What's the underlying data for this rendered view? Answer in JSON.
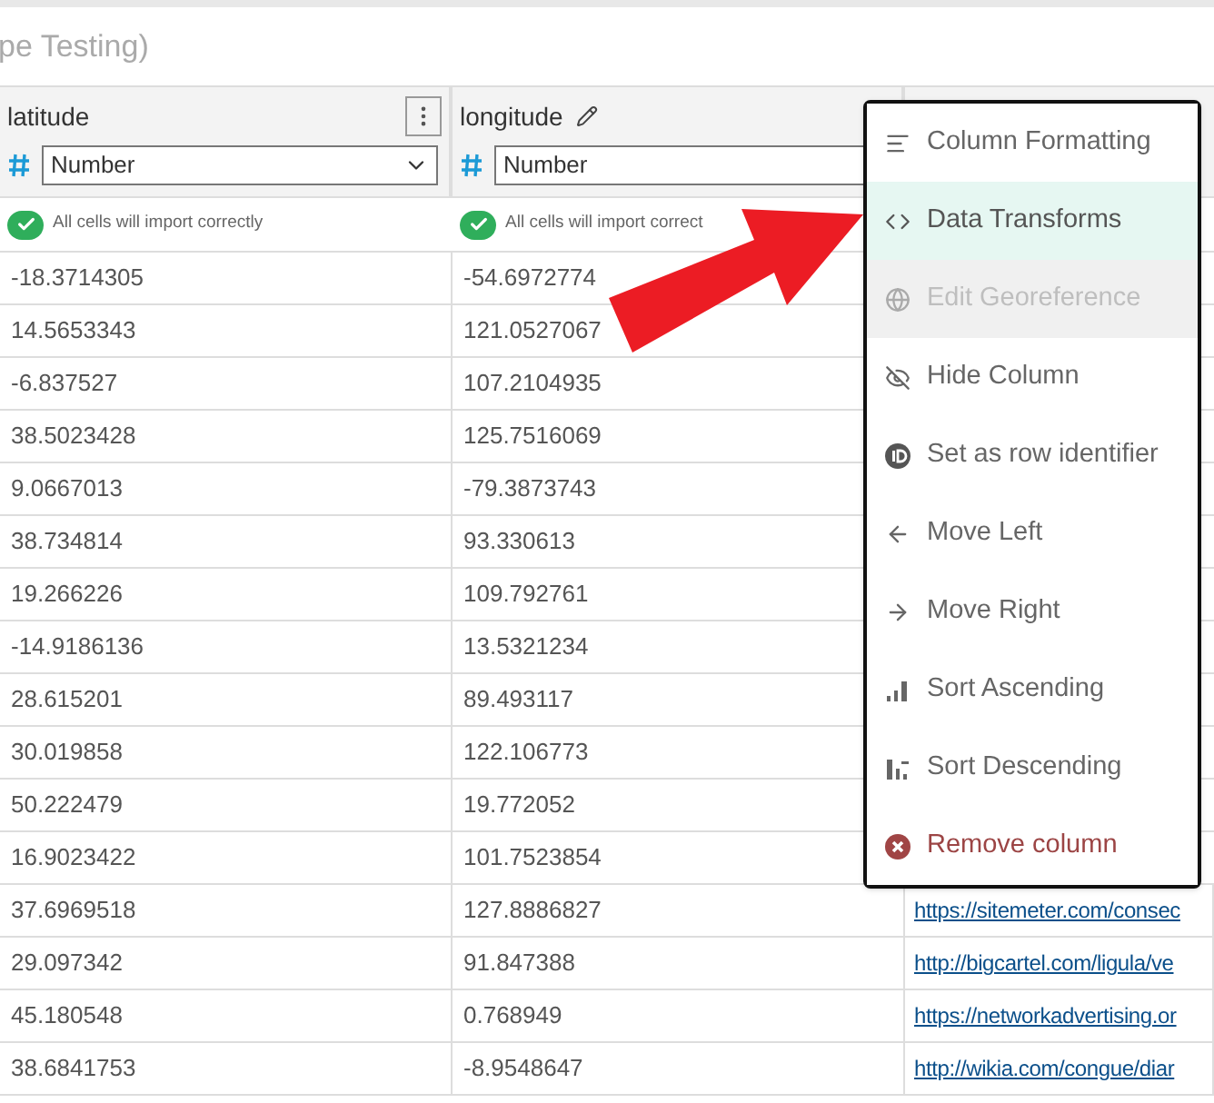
{
  "page_title": "pe Testing)",
  "columns": [
    {
      "name": "latitude",
      "kind": "menu",
      "type": "Number",
      "status": "All cells will import correctly"
    },
    {
      "name": "longitude",
      "kind": "edit",
      "type": "Number",
      "status": "All cells will import correct"
    }
  ],
  "rows": [
    {
      "cells": [
        "-18.3714305",
        "-54.6972774"
      ]
    },
    {
      "cells": [
        "14.5653343",
        "121.0527067"
      ]
    },
    {
      "cells": [
        "-6.837527",
        "107.2104935"
      ]
    },
    {
      "cells": [
        "38.5023428",
        "125.7516069"
      ]
    },
    {
      "cells": [
        "9.0667013",
        "-79.3873743"
      ]
    },
    {
      "cells": [
        "38.734814",
        "93.330613"
      ]
    },
    {
      "cells": [
        "19.266226",
        "109.792761"
      ]
    },
    {
      "cells": [
        "-14.9186136",
        "13.5321234"
      ]
    },
    {
      "cells": [
        "28.615201",
        "89.493117"
      ]
    },
    {
      "cells": [
        "30.019858",
        "122.106773"
      ]
    },
    {
      "cells": [
        "50.222479",
        "19.772052"
      ]
    },
    {
      "cells": [
        "16.9023422",
        "101.7523854"
      ]
    },
    {
      "cells": [
        "37.6969518",
        "127.8886827",
        "https://sitemeter.com/consec"
      ]
    },
    {
      "cells": [
        "29.097342",
        "91.847388",
        "http://bigcartel.com/ligula/ve"
      ]
    },
    {
      "cells": [
        "45.180548",
        "0.768949",
        "https://networkadvertising.or"
      ]
    },
    {
      "cells": [
        "38.6841753",
        "-8.9548647",
        "http://wikia.com/congue/diar"
      ]
    }
  ],
  "menu": [
    {
      "label": "Column Formatting",
      "selected": false,
      "disabled": false,
      "kind": "normal"
    },
    {
      "label": "Data Transforms",
      "selected": true,
      "disabled": false,
      "kind": "normal"
    },
    {
      "label": "Edit Georeference",
      "selected": false,
      "disabled": true,
      "kind": "normal"
    },
    {
      "label": "Hide Column",
      "selected": false,
      "disabled": false,
      "kind": "normal"
    },
    {
      "label": "Set as row identifier",
      "selected": false,
      "disabled": false,
      "kind": "normal"
    },
    {
      "label": "Move Left",
      "selected": false,
      "disabled": false,
      "kind": "normal"
    },
    {
      "label": "Move Right",
      "selected": false,
      "disabled": false,
      "kind": "normal"
    },
    {
      "label": "Sort Ascending",
      "selected": false,
      "disabled": false,
      "kind": "normal"
    },
    {
      "label": "Sort Descending",
      "selected": false,
      "disabled": false,
      "kind": "normal"
    },
    {
      "label": "Remove column",
      "selected": false,
      "disabled": false,
      "kind": "danger"
    }
  ]
}
